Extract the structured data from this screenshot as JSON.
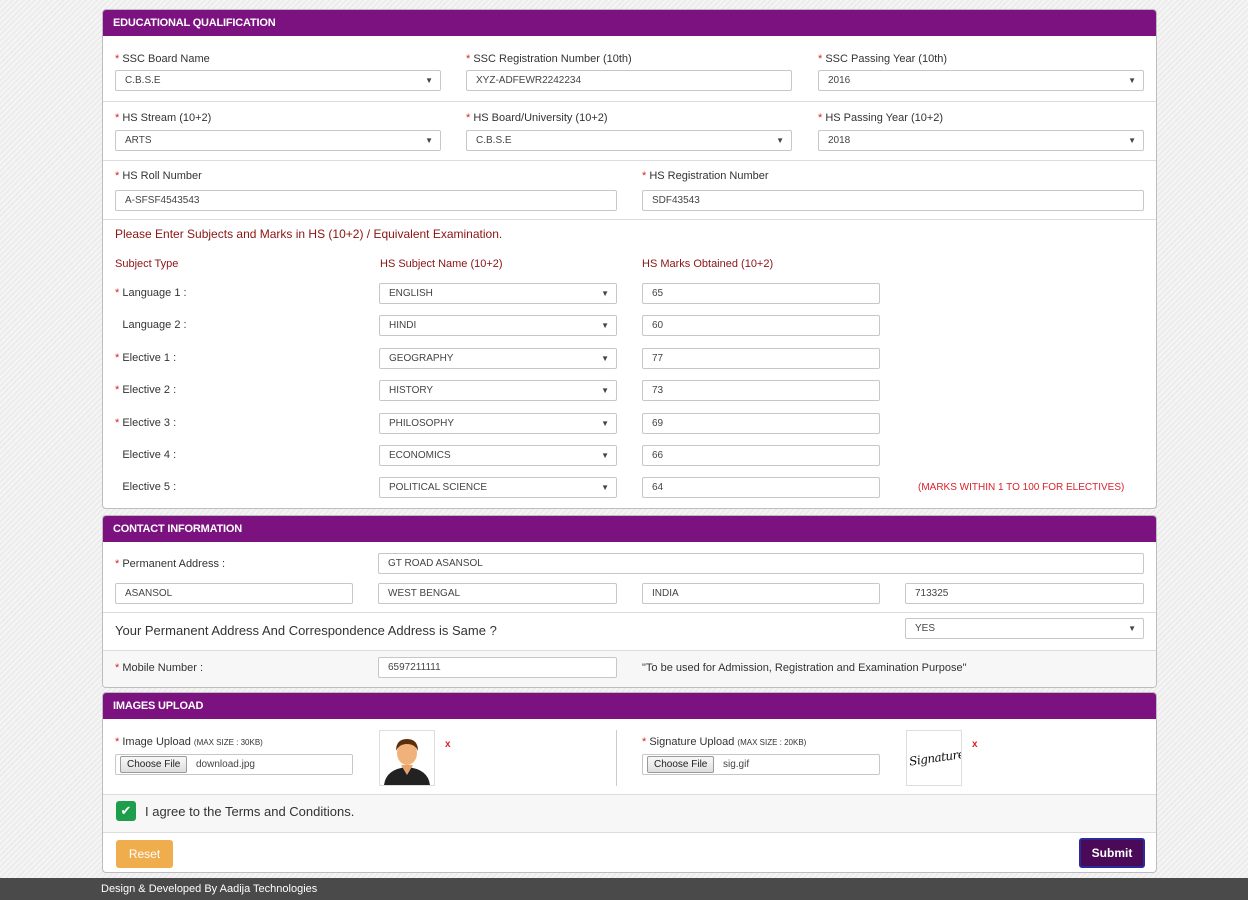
{
  "edu": {
    "title": "EDUCATIONAL QUALIFICATION",
    "ssc_board": {
      "label": "SSC Board Name",
      "value": "C.B.S.E"
    },
    "ssc_reg": {
      "label": "SSC Registration Number (10th)",
      "value": "XYZ-ADFEWR2242234"
    },
    "ssc_year": {
      "label": "SSC Passing Year (10th)",
      "value": "2016"
    },
    "hs_stream": {
      "label": "HS Stream (10+2)",
      "value": "ARTS"
    },
    "hs_board": {
      "label": "HS Board/University (10+2)",
      "value": "C.B.S.E"
    },
    "hs_year": {
      "label": "HS Passing Year (10+2)",
      "value": "2018"
    },
    "hs_roll": {
      "label": "HS Roll Number",
      "value": "A-SFSF4543543"
    },
    "hs_reg": {
      "label": "HS Registration Number",
      "value": "SDF43543"
    },
    "subjects_title": "Please Enter Subjects and Marks in HS (10+2) / Equivalent Examination.",
    "col_subject_type": "Subject Type",
    "col_subject_name": "HS Subject Name (10+2)",
    "col_marks": "HS Marks Obtained (10+2)",
    "subjects": [
      {
        "type": "Language 1 :",
        "name": "ENGLISH",
        "marks": "65",
        "required": true
      },
      {
        "type": "Language 2 :",
        "name": "HINDI",
        "marks": "60",
        "required": false
      },
      {
        "type": "Elective 1 :",
        "name": "GEOGRAPHY",
        "marks": "77",
        "required": true
      },
      {
        "type": "Elective 2 :",
        "name": "HISTORY",
        "marks": "73",
        "required": true
      },
      {
        "type": "Elective 3 :",
        "name": "PHILOSOPHY",
        "marks": "69",
        "required": true
      },
      {
        "type": "Elective 4 :",
        "name": "ECONOMICS",
        "marks": "66",
        "required": false
      },
      {
        "type": "Elective 5 :",
        "name": "POLITICAL SCIENCE",
        "marks": "64",
        "required": false
      }
    ],
    "marks_note": "(MARKS WITHIN 1 TO 100 FOR ELECTIVES)"
  },
  "contact": {
    "title": "CONTACT INFORMATION",
    "perm_label": "Permanent Address :",
    "address_line": "GT ROAD ASANSOL",
    "city": "ASANSOL",
    "state": "WEST BENGAL",
    "country": "INDIA",
    "pin": "713325",
    "same_question": "Your Permanent Address And Correspondence Address is Same ?",
    "same_value": "YES",
    "mobile_label": "Mobile Number :",
    "mobile_value": "6597211111",
    "mobile_note": "\"To be used for Admission, Registration and Examination Purpose\""
  },
  "images": {
    "title": "IMAGES UPLOAD",
    "image_label": "Image Upload",
    "image_size": "(MAX SIZE : 30KB)",
    "image_btn": "Choose File",
    "image_file": "download.jpg",
    "sig_label": "Signature Upload",
    "sig_size": "(MAX SIZE : 20KB)",
    "sig_btn": "Choose File",
    "sig_file": "sig.gif",
    "remove": "x",
    "sig_text": "Signature"
  },
  "terms": "I agree to the Terms and Conditions.",
  "buttons": {
    "reset": "Reset",
    "submit": "Submit"
  },
  "footer": "Design & Developed By Aadija Technologies",
  "colors": {
    "header": "#7b127f",
    "required": "#d9232d",
    "reset": "#f0ad4e",
    "submit": "#4a0a57",
    "check": "#1e9e4a"
  }
}
